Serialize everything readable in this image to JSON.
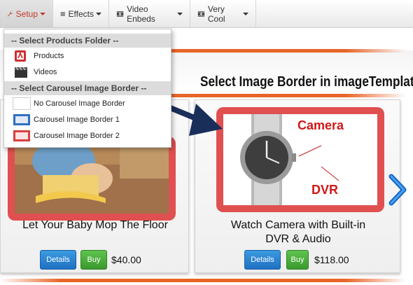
{
  "navbar": {
    "items": [
      {
        "label": "Setup",
        "icon": "wrench-icon"
      },
      {
        "label": "Effects",
        "icon": "list-icon"
      },
      {
        "label": "Video Enbeds",
        "icon": "film-icon"
      },
      {
        "label": "Very Cool",
        "icon": "film-icon"
      }
    ]
  },
  "dropdown": {
    "header_products": "-- Select Products Folder --",
    "products": "Products",
    "videos": "Videos",
    "header_border": "-- Select Carousel Image Border --",
    "no_border": "No Carousel Image Border",
    "border1": "Carousel Image Border 1",
    "border2": "Carousel Image Border 2"
  },
  "annotation": {
    "heading": "Select Image Border in imageTemplate",
    "camera_label": "Camera",
    "dvr_label": "DVR"
  },
  "carousel": {
    "products": [
      {
        "caption": "Let Your Baby Mop The Floor",
        "details": "Details",
        "buy": "Buy",
        "price": "$40.00"
      },
      {
        "caption_line1": "Watch Camera with Built-in",
        "caption_line2": "DVR & Audio",
        "details": "Details",
        "buy": "Buy",
        "price": "$118.00"
      }
    ]
  },
  "colors": {
    "accent": "#e86428",
    "frame": "#e05050",
    "details": "#1f6fc2",
    "buy": "#3a9a2e",
    "arrow": "#1a2e5a"
  }
}
